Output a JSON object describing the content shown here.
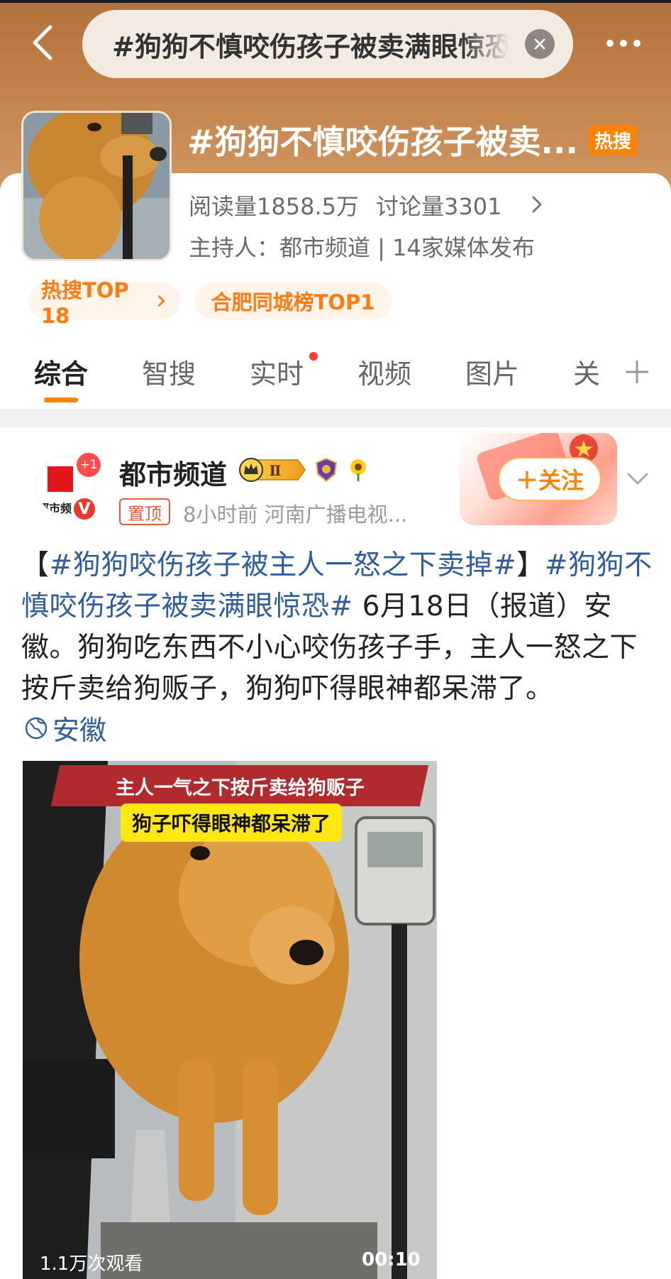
{
  "header": {
    "search_query": "#狗狗不慎咬伤孩子被卖满眼惊恐#",
    "back_icon": "chevron-left-icon",
    "clear_icon": "close-icon",
    "more_icon": "more-dots-icon"
  },
  "topic": {
    "title": "#狗狗不慎咬伤孩子被卖...",
    "hot_badge": "热搜",
    "reads": "阅读量1858.5万",
    "discussions": "讨论量3301",
    "host_line": "主持人：都市频道 | 14家媒体发布",
    "chips": [
      "热搜TOP 18",
      "合肥同城榜TOP1"
    ]
  },
  "tabs": {
    "items": [
      "综合",
      "智搜",
      "实时",
      "视频",
      "图片",
      "关"
    ],
    "active_index": 0,
    "add_icon": "plus-icon"
  },
  "post": {
    "author": "都市频道",
    "avatar_text": "都市频",
    "plus_one": "+1",
    "verified": "V",
    "level": "Ⅱ",
    "pinned": "置顶",
    "meta": "8小时前  河南广播电视...",
    "follow_label": "＋关注",
    "body_hashtag_1": "#狗狗咬伤孩子被主人一怒之下卖掉#",
    "body_bracket_open": "【",
    "body_bracket_close": "】",
    "body_hashtag_2": "#狗狗不慎咬伤孩子被卖满眼惊恐#",
    "body_text": " 6月18日（报道）安徽。狗狗吃东西不小心咬伤孩子手，主人一怒之下按斤卖给狗贩子，狗狗吓得眼神都呆滞了。",
    "location": "安徽",
    "video": {
      "caption_top": "主人一气之下按斤卖给狗贩子",
      "caption_sub": "狗子吓得眼神都呆滞了",
      "views": "1.1万次观看",
      "duration": "00:10"
    }
  },
  "colors": {
    "accent": "#ff8200",
    "hashtag": "#2e5e9b",
    "hot": "#ff8200"
  }
}
